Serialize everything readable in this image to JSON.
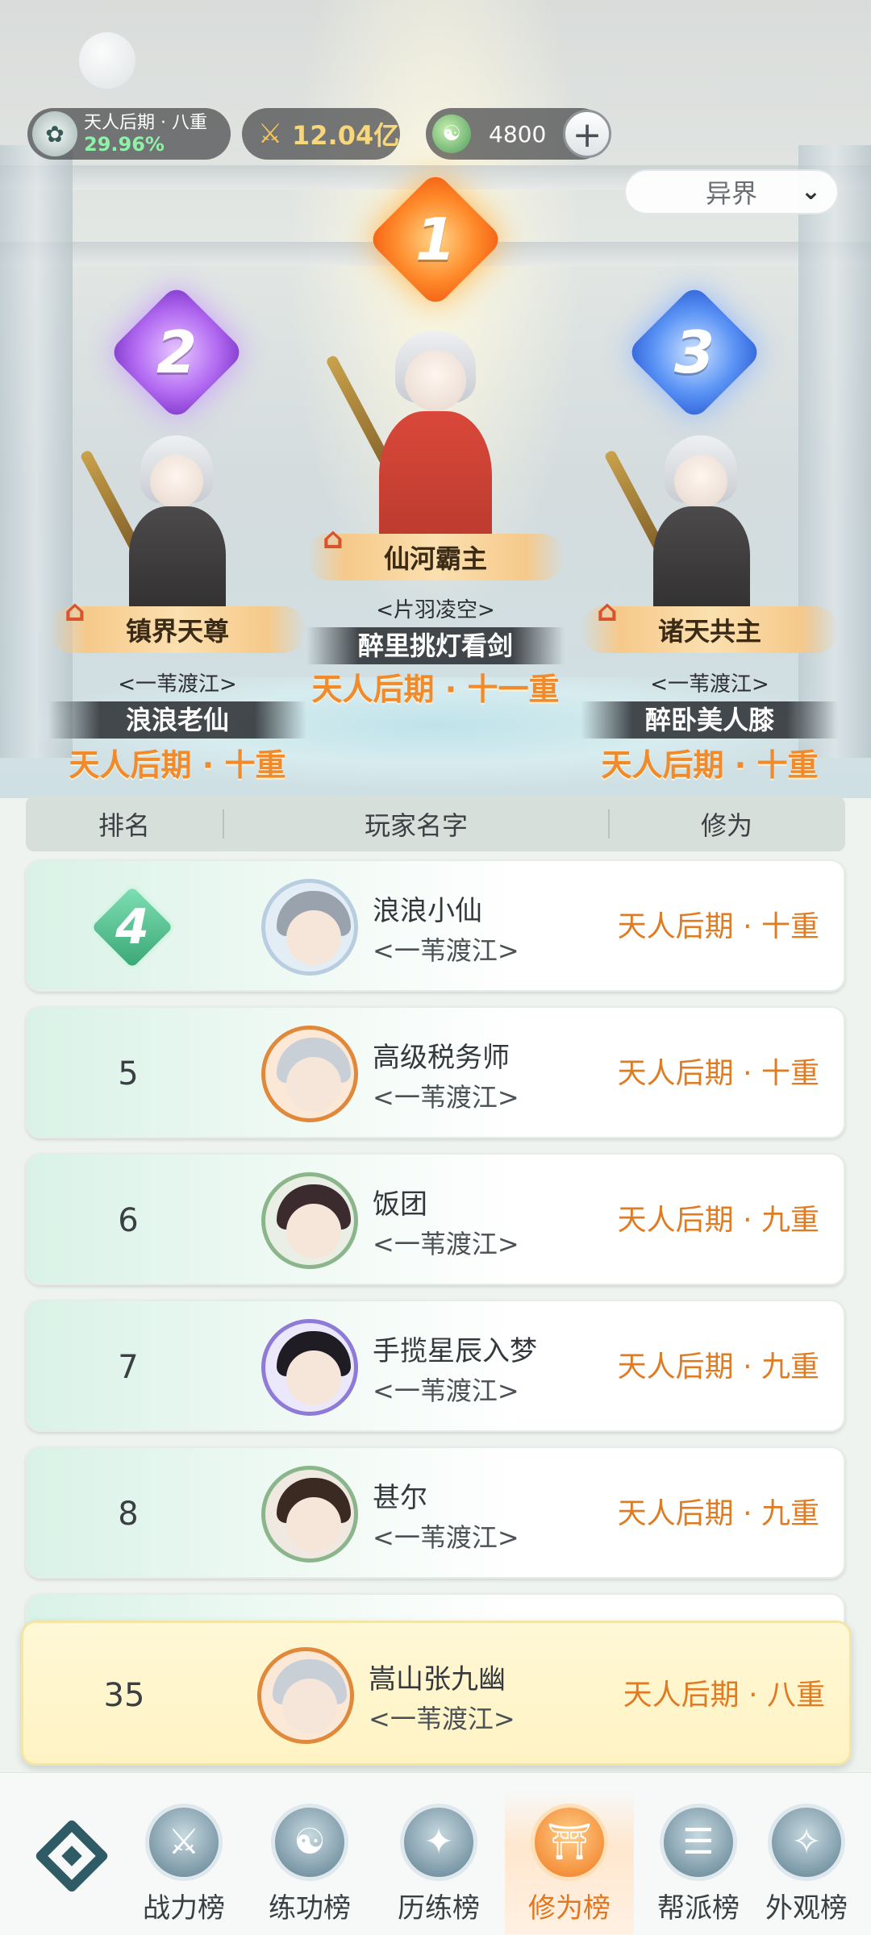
{
  "topbar": {
    "realm_label": "天人后期 · 八重",
    "realm_progress": "29.96%",
    "power_value": "12.04亿",
    "jade_value": "4800",
    "plus_label": "+"
  },
  "realm_select": {
    "value": "异界"
  },
  "podium": [
    {
      "rank": "1",
      "title": "仙河霸主",
      "guild": "<片羽凌空>",
      "player": "醉里挑灯看剑",
      "level": "天人后期 · 十一重"
    },
    {
      "rank": "2",
      "title": "镇界天尊",
      "guild": "<一苇渡江>",
      "player": "浪浪老仙",
      "level": "天人后期 · 十重"
    },
    {
      "rank": "3",
      "title": "诸天共主",
      "guild": "<一苇渡江>",
      "player": "醉卧美人膝",
      "level": "天人后期 · 十重"
    }
  ],
  "table": {
    "headers": [
      "排名",
      "玩家名字",
      "修为"
    ],
    "rows": [
      {
        "rank": "4",
        "name": "浪浪小仙",
        "guild": "<一苇渡江>",
        "level": "天人后期 · 十重"
      },
      {
        "rank": "5",
        "name": "高级税务师",
        "guild": "<一苇渡江>",
        "level": "天人后期 · 十重"
      },
      {
        "rank": "6",
        "name": "饭团",
        "guild": "<一苇渡江>",
        "level": "天人后期 · 九重"
      },
      {
        "rank": "7",
        "name": "手揽星辰入梦",
        "guild": "<一苇渡江>",
        "level": "天人后期 · 九重"
      },
      {
        "rank": "8",
        "name": "甚尔",
        "guild": "<一苇渡江>",
        "level": "天人后期 · 九重"
      }
    ],
    "my_row": {
      "rank": "35",
      "name": "嵩山张九幽",
      "guild": "<一苇渡江>",
      "level": "天人后期 · 八重"
    }
  },
  "nav": {
    "items": [
      {
        "label": "战力榜",
        "icon": "sword-icon"
      },
      {
        "label": "练功榜",
        "icon": "taiji-icon"
      },
      {
        "label": "历练榜",
        "icon": "compass-icon"
      },
      {
        "label": "修为榜",
        "icon": "bamboo-hat-icon"
      },
      {
        "label": "帮派榜",
        "icon": "scroll-icon"
      },
      {
        "label": "外观榜",
        "icon": "costume-icon"
      }
    ],
    "active": "修为榜"
  },
  "colors": {
    "accent": "#e07b22",
    "progress": "#8ff0a8",
    "rank_badge": "#3aa676"
  }
}
